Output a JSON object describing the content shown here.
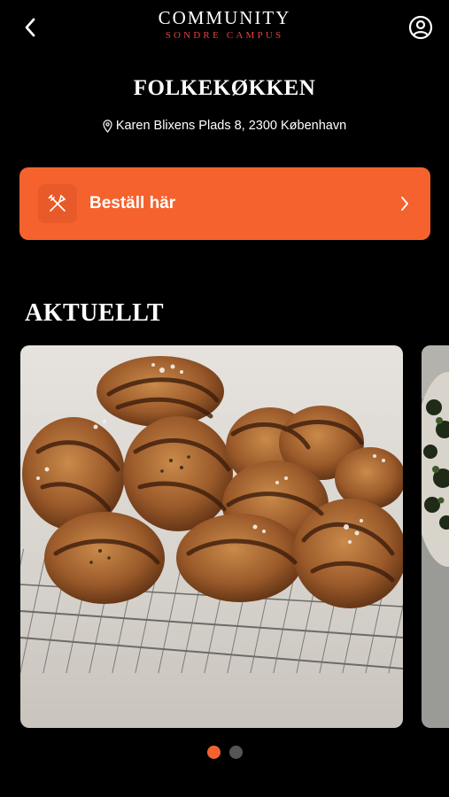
{
  "header": {
    "title": "COMMUNITY",
    "subtitle": "SONDRE CAMPUS",
    "back_icon": "chevron-left-icon",
    "profile_icon": "user-circle-icon",
    "accent_color": "#e8413a"
  },
  "venue": {
    "name": "FOLKEKØKKEN",
    "address": "Karen Blixens Plads 8, 2300 København",
    "address_icon": "map-pin-icon"
  },
  "order": {
    "label": "Beställ här",
    "icon": "fork-knife-icon",
    "chevron_icon": "chevron-right-icon",
    "color": "#f5622d"
  },
  "news": {
    "title": "AKTUELLT",
    "cards": [
      {
        "image": "cinnamon-buns-photo"
      },
      {
        "image": "herb-dish-photo"
      }
    ],
    "dots": [
      {
        "active": true,
        "color": "#f5622d"
      },
      {
        "active": false,
        "color": "#555555"
      }
    ]
  }
}
